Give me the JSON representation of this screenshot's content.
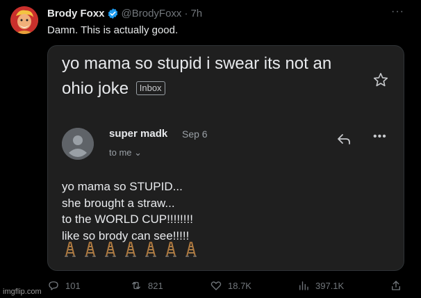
{
  "tweet": {
    "author_name": "Brody Foxx",
    "handle": "@BrodyFoxx",
    "separator": "·",
    "time": "7h",
    "text": "Damn. This is actually good."
  },
  "email": {
    "subject": "yo mama so stupid i swear its not an ohio joke",
    "label": "Inbox",
    "sender": "super madk",
    "date": "Sep 6",
    "recipient": "to me",
    "body_lines": [
      "yo mama so STUPID...",
      "she brought a straw...",
      "to the WORLD CUP!!!!!!!!",
      "like so brody can see!!!!!"
    ],
    "emoji_count": 7
  },
  "stats": {
    "replies": "101",
    "reposts": "821",
    "likes": "18.7K",
    "views": "397.1K"
  },
  "watermark": "imgflip.com",
  "colors": {
    "background": "#000000",
    "card": "#1f1f1f",
    "verified": "#1d9bf0",
    "muted": "#71767b"
  }
}
